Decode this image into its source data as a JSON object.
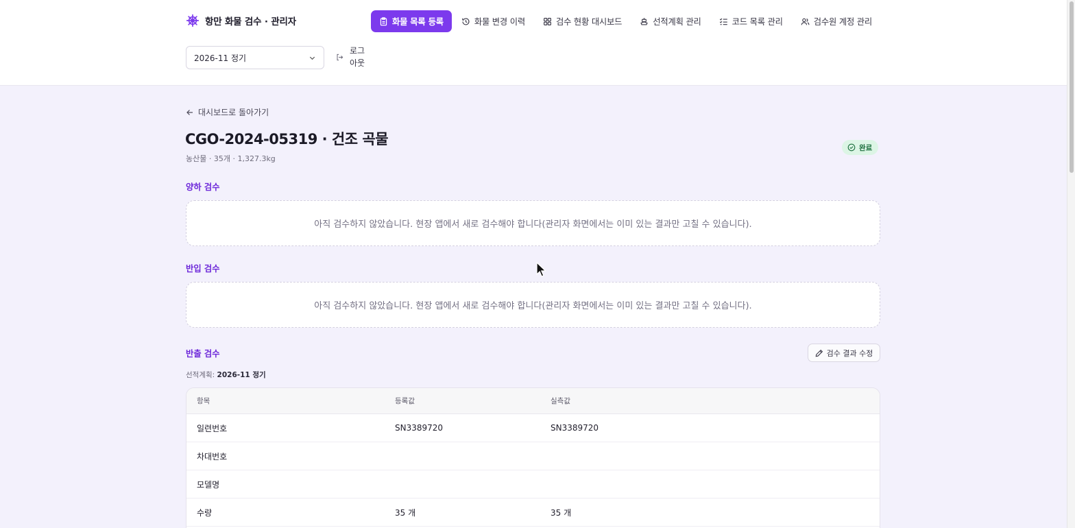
{
  "app": {
    "title": "항만 화물 검수 · 관리자"
  },
  "nav": {
    "items": [
      {
        "label": "화물 목록 등록",
        "icon": "clipboard-icon",
        "active": true
      },
      {
        "label": "화물 변경 이력",
        "icon": "history-icon",
        "active": false
      },
      {
        "label": "검수 현황 대시보드",
        "icon": "dashboard-grid-icon",
        "active": false
      },
      {
        "label": "선적계획 관리",
        "icon": "ship-icon",
        "active": false
      },
      {
        "label": "코드 목록 관리",
        "icon": "checklist-icon",
        "active": false
      },
      {
        "label": "검수원 계정 관리",
        "icon": "users-icon",
        "active": false
      }
    ]
  },
  "header": {
    "period_select": "2026-11 정기",
    "logout_label": "로그아웃"
  },
  "page": {
    "back_link": "대시보드로 돌아가기",
    "title": "CGO-2024-05319 · 건조 곡물",
    "subtitle": "농산물 · 35개 · 1,327.3kg",
    "status": "완료"
  },
  "sections": {
    "unloading": {
      "title": "양하 검수",
      "empty_message": "아직 검수하지 않았습니다. 현장 앱에서 새로 검수해야 합니다(관리자 화면에서는 이미 있는 결과만 고칠 수 있습니다)."
    },
    "inbound": {
      "title": "반입 검수",
      "empty_message": "아직 검수하지 않았습니다. 현장 앱에서 새로 검수해야 합니다(관리자 화면에서는 이미 있는 결과만 고칠 수 있습니다)."
    },
    "outbound": {
      "title": "반출 검수",
      "edit_button": "검수 결과 수정",
      "plan_label": "선적계획:",
      "plan_value": "2026-11 정기",
      "table": {
        "headers": [
          "항목",
          "등록값",
          "실측값"
        ],
        "rows": [
          {
            "item": "일련번호",
            "registered": "SN3389720",
            "measured": "SN3389720"
          },
          {
            "item": "차대번호",
            "registered": "",
            "measured": ""
          },
          {
            "item": "모델명",
            "registered": "",
            "measured": ""
          },
          {
            "item": "수량",
            "registered": "35 개",
            "measured": "35 개"
          }
        ]
      }
    }
  },
  "colors": {
    "accent": "#7c3aed",
    "section_title": "#6d28d9",
    "background": "#f3f1fc",
    "status_bg": "#dcf5e5",
    "status_text": "#1b6e3c"
  }
}
